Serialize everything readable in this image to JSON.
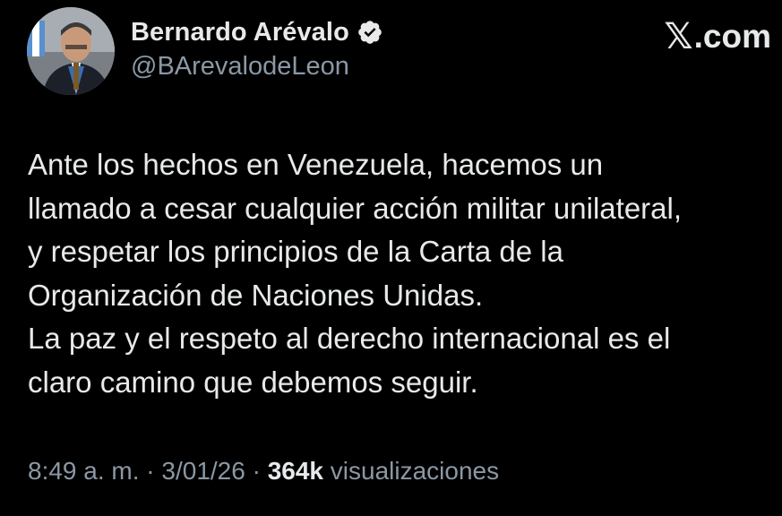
{
  "author": {
    "display_name": "Bernardo Arévalo",
    "handle": "@BArevalodeLeon",
    "verified_icon": "verified-badge-icon",
    "avatar_icon": "profile-photo"
  },
  "brand": {
    "symbol": "𝕏",
    "text": ".com"
  },
  "post": {
    "lines": [
      "Ante los hechos en Venezuela, hacemos un",
      "llamado a cesar cualquier acción militar unilateral,",
      "y respetar los principios de la Carta de la",
      "Organización de Naciones Unidas.",
      "La paz y el respeto al derecho internacional es el",
      "claro camino que debemos seguir."
    ]
  },
  "meta": {
    "time": "8:49 a. m.",
    "separator": " · ",
    "date": "3/01/26",
    "views_count": "364k",
    "views_label": "visualizaciones"
  },
  "colors": {
    "background": "#000000",
    "primary_text": "#e7e9ea",
    "secondary_text": "#8b98a5",
    "verified": "#e7e9ea"
  }
}
